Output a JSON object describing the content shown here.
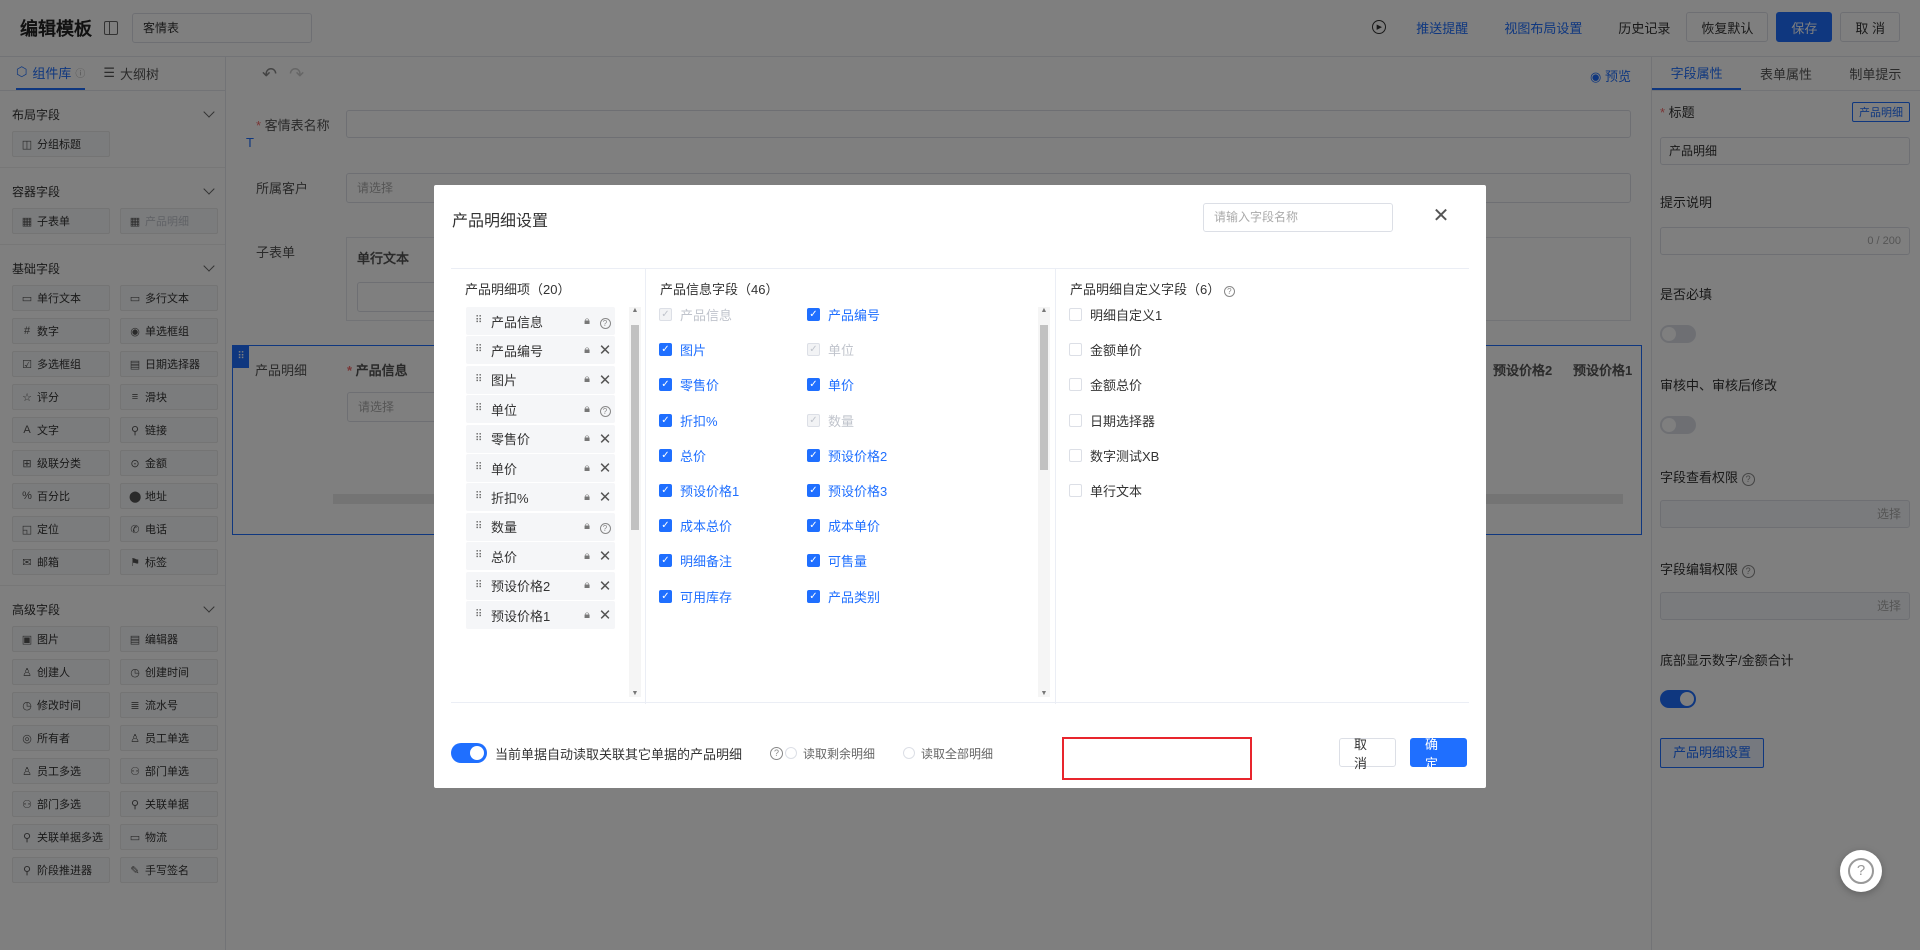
{
  "header": {
    "title": "编辑模板",
    "template_name": "客情表",
    "links": {
      "push": "推送提醒",
      "view_layout": "视图布局设置"
    },
    "history": "历史记录",
    "restore": "恢复默认",
    "save": "保存",
    "cancel": "取 消"
  },
  "left": {
    "tabs": [
      "组件库",
      "大纲树"
    ],
    "groups": [
      {
        "title": "布局字段",
        "items": [
          {
            "label": "分组标题",
            "icon": "◫"
          }
        ]
      },
      {
        "title": "容器字段",
        "items": [
          {
            "label": "子表单",
            "icon": "▦"
          },
          {
            "label": "产品明细",
            "icon": "▦",
            "disabled": true
          }
        ]
      },
      {
        "title": "基础字段",
        "items": [
          {
            "label": "单行文本",
            "icon": "▭"
          },
          {
            "label": "多行文本",
            "icon": "▭"
          },
          {
            "label": "数字",
            "icon": "#"
          },
          {
            "label": "单选框组",
            "icon": "◉"
          },
          {
            "label": "多选框组",
            "icon": "☑"
          },
          {
            "label": "日期选择器",
            "icon": "▤"
          },
          {
            "label": "评分",
            "icon": "☆"
          },
          {
            "label": "滑块",
            "icon": "≡"
          },
          {
            "label": "文字",
            "icon": "A"
          },
          {
            "label": "链接",
            "icon": "⚲"
          },
          {
            "label": "级联分类",
            "icon": "⊞"
          },
          {
            "label": "金额",
            "icon": "⊙"
          },
          {
            "label": "百分比",
            "icon": "%"
          },
          {
            "label": "地址",
            "icon": "⬤"
          },
          {
            "label": "定位",
            "icon": "◱"
          },
          {
            "label": "电话",
            "icon": "✆"
          },
          {
            "label": "邮箱",
            "icon": "✉"
          },
          {
            "label": "标签",
            "icon": "⚑"
          }
        ]
      },
      {
        "title": "高级字段",
        "items": [
          {
            "label": "图片",
            "icon": "▣"
          },
          {
            "label": "编辑器",
            "icon": "▤"
          },
          {
            "label": "创建人",
            "icon": "♙"
          },
          {
            "label": "创建时间",
            "icon": "◷"
          },
          {
            "label": "修改时间",
            "icon": "◷"
          },
          {
            "label": "流水号",
            "icon": "≣"
          },
          {
            "label": "所有者",
            "icon": "◎"
          },
          {
            "label": "员工单选",
            "icon": "♙"
          },
          {
            "label": "员工多选",
            "icon": "♙"
          },
          {
            "label": "部门单选",
            "icon": "⚇"
          },
          {
            "label": "部门多选",
            "icon": "⚇"
          },
          {
            "label": "关联单据",
            "icon": "⚲"
          },
          {
            "label": "关联单据多选",
            "icon": "⚲"
          },
          {
            "label": "物流",
            "icon": "▭"
          },
          {
            "label": "阶段推进器",
            "icon": "⚲"
          },
          {
            "label": "手写签名",
            "icon": "✎"
          }
        ]
      }
    ]
  },
  "canvas": {
    "preview": "预览",
    "fields": {
      "name_label": "客情表名称",
      "customer_label": "所属客户",
      "customer_placeholder": "请选择",
      "subform_label": "子表单",
      "subform_col": "单行文本",
      "detail_label": "产品明细",
      "detail_col": "产品信息",
      "detail_placeholder": "请选择",
      "detail_col2": "预设价格2",
      "detail_col3": "预设价格1"
    }
  },
  "right": {
    "tabs": [
      "字段属性",
      "表单属性",
      "制单提示"
    ],
    "title_label": "标题",
    "title_tag": "产品明细",
    "title_value": "产品明细",
    "hint_label": "提示说明",
    "hint_count": "0 / 200",
    "required_label": "是否必填",
    "audit_label": "审核中、审核后修改",
    "view_perm_label": "字段查看权限",
    "edit_perm_label": "字段编辑权限",
    "select": "选择",
    "sum_label": "底部显示数字/金额合计",
    "detail_btn": "产品明细设置"
  },
  "dialog": {
    "title": "产品明细设置",
    "search_placeholder": "请输入字段名称",
    "col1_title": "产品明细项（20）",
    "col2_title": "产品信息字段（46）",
    "col3_title": "产品明细自定义字段（6）",
    "detail_items": [
      {
        "label": "产品信息",
        "icon": "lock-help"
      },
      {
        "label": "产品编号",
        "icon": "lock-close"
      },
      {
        "label": "图片",
        "icon": "lock-close"
      },
      {
        "label": "单位",
        "icon": "lock-help"
      },
      {
        "label": "零售价",
        "icon": "lock-close"
      },
      {
        "label": "单价",
        "icon": "lock-close"
      },
      {
        "label": "折扣%",
        "icon": "lock-close"
      },
      {
        "label": "数量",
        "icon": "lock-help"
      },
      {
        "label": "总价",
        "icon": "lock-close"
      },
      {
        "label": "预设价格2",
        "icon": "lock-close"
      },
      {
        "label": "预设价格1",
        "icon": "lock-close"
      }
    ],
    "info_fields": [
      {
        "label": "产品信息",
        "state": "disabled"
      },
      {
        "label": "产品编号",
        "state": "checked"
      },
      {
        "label": "图片",
        "state": "checked"
      },
      {
        "label": "单位",
        "state": "disabled"
      },
      {
        "label": "零售价",
        "state": "checked"
      },
      {
        "label": "单价",
        "state": "checked"
      },
      {
        "label": "折扣%",
        "state": "checked"
      },
      {
        "label": "数量",
        "state": "disabled"
      },
      {
        "label": "总价",
        "state": "checked"
      },
      {
        "label": "预设价格2",
        "state": "checked"
      },
      {
        "label": "预设价格1",
        "state": "checked"
      },
      {
        "label": "预设价格3",
        "state": "checked"
      },
      {
        "label": "成本总价",
        "state": "checked"
      },
      {
        "label": "成本单价",
        "state": "checked"
      },
      {
        "label": "明细备注",
        "state": "checked"
      },
      {
        "label": "可售量",
        "state": "checked"
      },
      {
        "label": "可用库存",
        "state": "checked"
      },
      {
        "label": "产品类别",
        "state": "checked"
      }
    ],
    "custom_fields": [
      "明细自定义1",
      "金额单价",
      "金额总价",
      "日期选择器",
      "数字测试XB",
      "单行文本"
    ],
    "auto_read_label": "当前单据自动读取关联其它单据的产品明细",
    "radio_remaining": "读取剩余明细",
    "radio_all": "读取全部明细",
    "cancel": "取 消",
    "ok": "确 定"
  },
  "colors": {
    "primary": "#1f6fff",
    "highlight": "#e8252d"
  }
}
